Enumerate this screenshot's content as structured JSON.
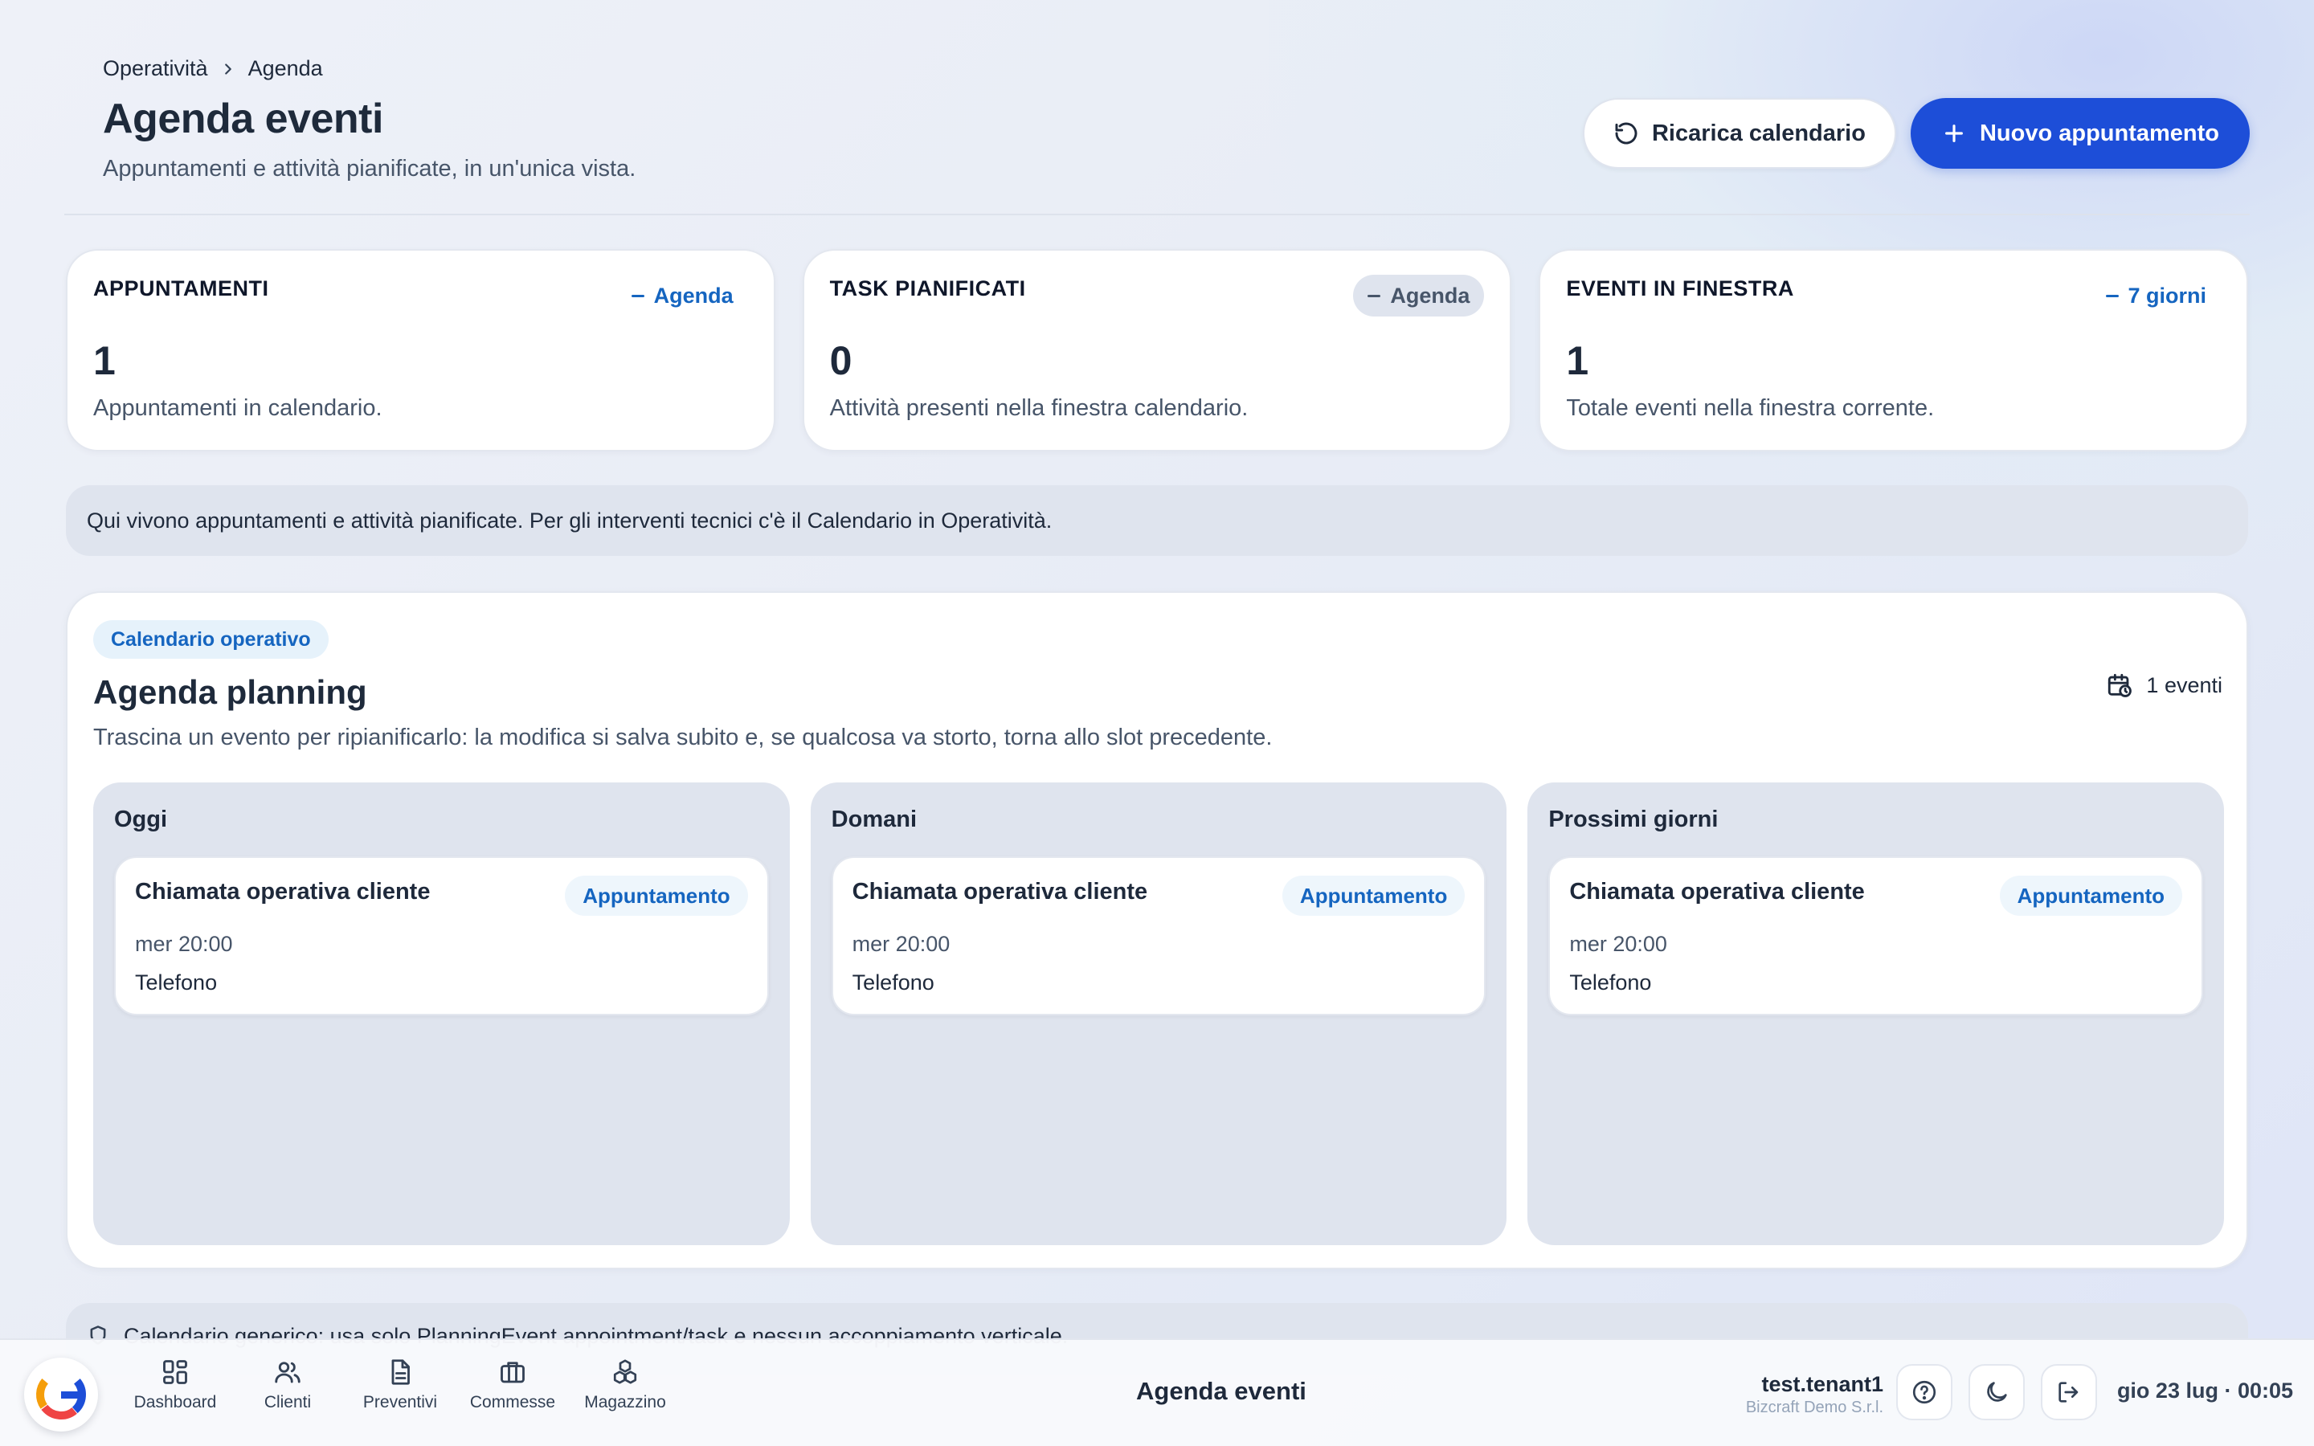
{
  "breadcrumb": {
    "parent": "Operatività",
    "current": "Agenda"
  },
  "header": {
    "title": "Agenda eventi",
    "subtitle": "Appuntamenti e attività pianificate, in un'unica vista.",
    "reload_label": "Ricarica calendario",
    "new_label": "Nuovo appuntamento"
  },
  "stats": [
    {
      "label": "APPUNTAMENTI",
      "pill": "Agenda",
      "value": "1",
      "desc": "Appuntamenti in calendario."
    },
    {
      "label": "TASK PIANIFICATI",
      "pill": "Agenda",
      "value": "0",
      "desc": "Attività presenti nella finestra calendario."
    },
    {
      "label": "EVENTI IN FINESTRA",
      "pill": "7 giorni",
      "value": "1",
      "desc": "Totale eventi nella finestra corrente."
    }
  ],
  "info_banner": "Qui vivono appuntamenti e attività pianificate. Per gli interventi tecnici c'è il Calendario in Operatività.",
  "planning": {
    "badge": "Calendario operativo",
    "title": "Agenda planning",
    "desc": "Trascina un evento per ripianificarlo: la modifica si salva subito e, se qualcosa va storto, torna allo slot precedente.",
    "event_count": "1 eventi",
    "columns": [
      {
        "title": "Oggi",
        "event": {
          "title": "Chiamata operativa cliente",
          "type": "Appuntamento",
          "time": "mer 20:00",
          "place": "Telefono"
        }
      },
      {
        "title": "Domani",
        "event": {
          "title": "Chiamata operativa cliente",
          "type": "Appuntamento",
          "time": "mer 20:00",
          "place": "Telefono"
        }
      },
      {
        "title": "Prossimi giorni",
        "event": {
          "title": "Chiamata operativa cliente",
          "type": "Appuntamento",
          "time": "mer 20:00",
          "place": "Telefono"
        }
      }
    ]
  },
  "footnote": "Calendario generico: usa solo PlanningEvent appointment/task e nessun accoppiamento verticale.",
  "bottombar": {
    "nav": [
      {
        "label": "Dashboard",
        "icon": "dashboard-icon"
      },
      {
        "label": "Clienti",
        "icon": "users-icon"
      },
      {
        "label": "Preventivi",
        "icon": "document-icon"
      },
      {
        "label": "Commesse",
        "icon": "briefcase-icon"
      },
      {
        "label": "Magazzino",
        "icon": "boxes-icon"
      }
    ],
    "title": "Agenda eventi",
    "user_name": "test.tenant1",
    "company": "Bizcraft Demo S.r.l.",
    "clock": "gio 23 lug · 00:05"
  },
  "colors": {
    "primary": "#1d4ed8",
    "accent_text": "#1565c0",
    "muted_bg": "#dfe4ee"
  }
}
